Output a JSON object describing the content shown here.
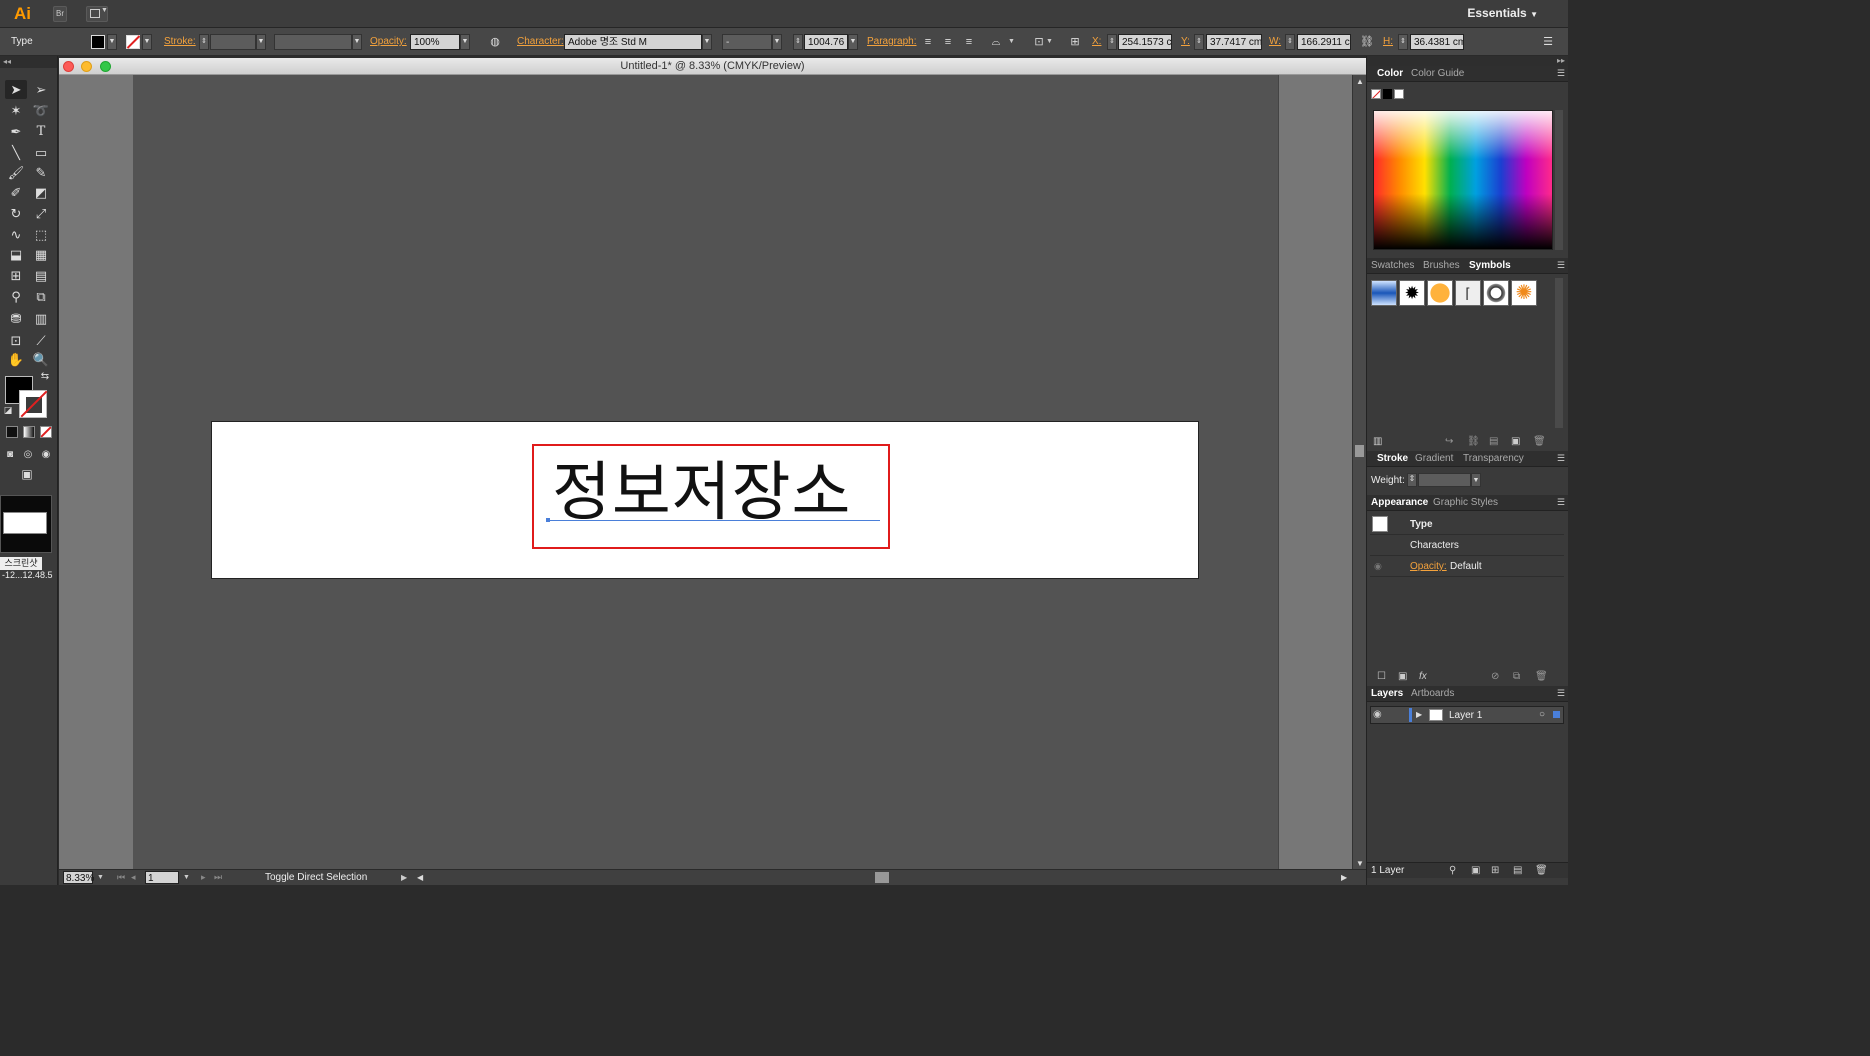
{
  "app": {
    "logo": "Ai",
    "bridge_label": "Br",
    "workspace": "Essentials"
  },
  "control_bar": {
    "mode": "Type",
    "stroke_label": "Stroke:",
    "opacity_label": "Opacity:",
    "opacity_value": "100%",
    "character_label": "Character:",
    "font_family": "Adobe 명조 Std M",
    "font_style": "-",
    "font_size": "1004.76",
    "paragraph_label": "Paragraph:",
    "x_label": "X:",
    "x_value": "254.1573 cı",
    "y_label": "Y:",
    "y_value": "37.7417 cm",
    "w_label": "W:",
    "w_value": "166.2911 cı",
    "h_label": "H:",
    "h_value": "36.4381 cm"
  },
  "document": {
    "title": "Untitled-1* @ 8.33% (CMYK/Preview)",
    "text": "정보저장소",
    "zoom": "8.33%",
    "artboard_number": "1",
    "status": "Toggle Direct Selection"
  },
  "left_strip": {
    "thumb_label": "스크린샷",
    "thumb_sub": "-12...12.48.5"
  },
  "panels": {
    "color_tabs": [
      "Color",
      "Color Guide"
    ],
    "swatch_tabs": [
      "Swatches",
      "Brushes",
      "Symbols"
    ],
    "stroke_tabs": [
      "Stroke",
      "Gradient",
      "Transparency"
    ],
    "weight_label": "Weight:",
    "appearance_tabs": [
      "Appearance",
      "Graphic Styles"
    ],
    "appearance_rows": {
      "type": "Type",
      "characters": "Characters",
      "opacity_label": "Opacity:",
      "opacity_value": "Default"
    },
    "layers_tabs": [
      "Layers",
      "Artboards"
    ],
    "layer_name": "Layer 1",
    "layers_count": "1 Layer"
  },
  "colors": {
    "accent": "#f4a23c",
    "selection_red": "#e01b1b",
    "baseline_blue": "#4a7fd9"
  }
}
